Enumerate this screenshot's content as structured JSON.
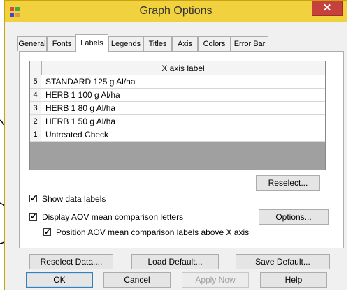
{
  "window": {
    "title": "Graph Options",
    "close_glyph": "✕",
    "app_icon": "grid-app-icon"
  },
  "tabs": [
    {
      "label": "General",
      "active": false
    },
    {
      "label": "Fonts",
      "active": false
    },
    {
      "label": "Labels",
      "active": true
    },
    {
      "label": "Legends",
      "active": false
    },
    {
      "label": "Titles",
      "active": false
    },
    {
      "label": "Axis",
      "active": false
    },
    {
      "label": "Colors",
      "active": false
    },
    {
      "label": "Error Bar",
      "active": false
    }
  ],
  "grid": {
    "column_header": "X axis label",
    "rows": [
      {
        "num": "5",
        "label": "STANDARD 125 g Al/ha"
      },
      {
        "num": "4",
        "label": "HERB 1 100 g Al/ha"
      },
      {
        "num": "3",
        "label": "HERB 1 80 g Al/ha"
      },
      {
        "num": "2",
        "label": "HERB 1 50 g Al/ha"
      },
      {
        "num": "1",
        "label": "Untreated Check"
      }
    ]
  },
  "reselect_button": "Reselect...",
  "checks": {
    "show_data_labels": {
      "label": "Show data labels",
      "checked": true
    },
    "display_aov": {
      "label": "Display AOV mean comparison letters",
      "checked": true
    },
    "position_aov": {
      "label": "Position AOV mean comparison labels above X axis",
      "checked": true
    }
  },
  "options_button": "Options...",
  "bottom_buttons": {
    "reselect_data": "Reselect Data....",
    "load_default": "Load Default...",
    "save_default": "Save Default...",
    "ok": "OK",
    "cancel": "Cancel",
    "apply_now": "Apply Now",
    "help": "Help"
  },
  "colors": {
    "titlebar": "#f2d13f",
    "close": "#c7413c",
    "arrow": "#000000"
  }
}
